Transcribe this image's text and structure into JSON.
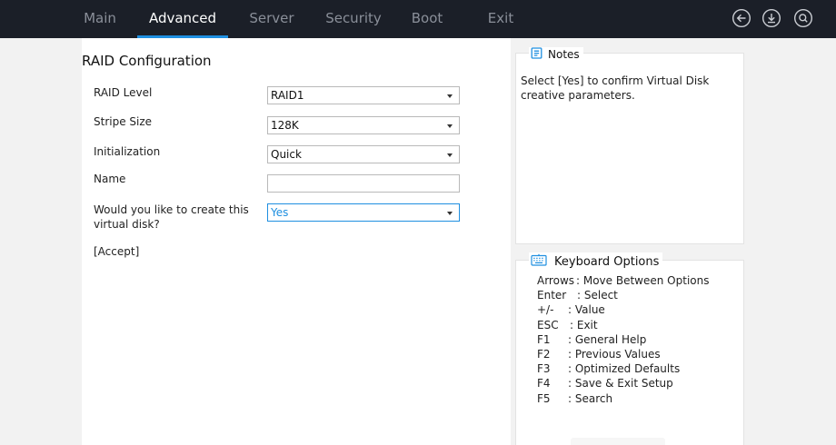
{
  "nav": {
    "tabs": [
      {
        "label": "Main",
        "active": false
      },
      {
        "label": "Advanced",
        "active": true
      },
      {
        "label": "Server",
        "active": false
      },
      {
        "label": "Security",
        "active": false
      },
      {
        "label": "Boot",
        "active": false
      },
      {
        "label": "Exit",
        "active": false
      }
    ],
    "icons": [
      "back-icon",
      "download-icon",
      "search-icon"
    ]
  },
  "main": {
    "title": "RAID Configuration",
    "rows": [
      {
        "label": "RAID Level",
        "value": "RAID1",
        "type": "select"
      },
      {
        "label": "Stripe Size",
        "value": "128K",
        "type": "select"
      },
      {
        "label": "Initialization",
        "value": "Quick",
        "type": "select"
      },
      {
        "label": "Name",
        "value": "",
        "type": "text"
      },
      {
        "label": "Would you like to create this virtual disk?",
        "value": "Yes",
        "type": "select",
        "selected": true
      }
    ],
    "accept_label": "[Accept]"
  },
  "notes": {
    "title": "Notes",
    "text": "Select [Yes] to confirm Virtual Disk creative parameters."
  },
  "keyboard": {
    "title": "Keyboard Options",
    "items": [
      {
        "key": "Arrows",
        "desc": ": Move Between Options"
      },
      {
        "key": "Enter",
        "desc": ": Select"
      },
      {
        "key": "+/-",
        "desc": ": Value"
      },
      {
        "key": "ESC",
        "desc": ": Exit"
      },
      {
        "key": "F1",
        "desc": ": General Help"
      },
      {
        "key": "F2",
        "desc": ": Previous Values"
      },
      {
        "key": "F3",
        "desc": ": Optimized Defaults"
      },
      {
        "key": "F4",
        "desc": ": Save & Exit Setup"
      },
      {
        "key": "F5",
        "desc": ": Search"
      }
    ]
  },
  "colors": {
    "topbar": "#1b1f28",
    "accent": "#1f8fe0",
    "tab_inactive": "#8a8f99"
  }
}
